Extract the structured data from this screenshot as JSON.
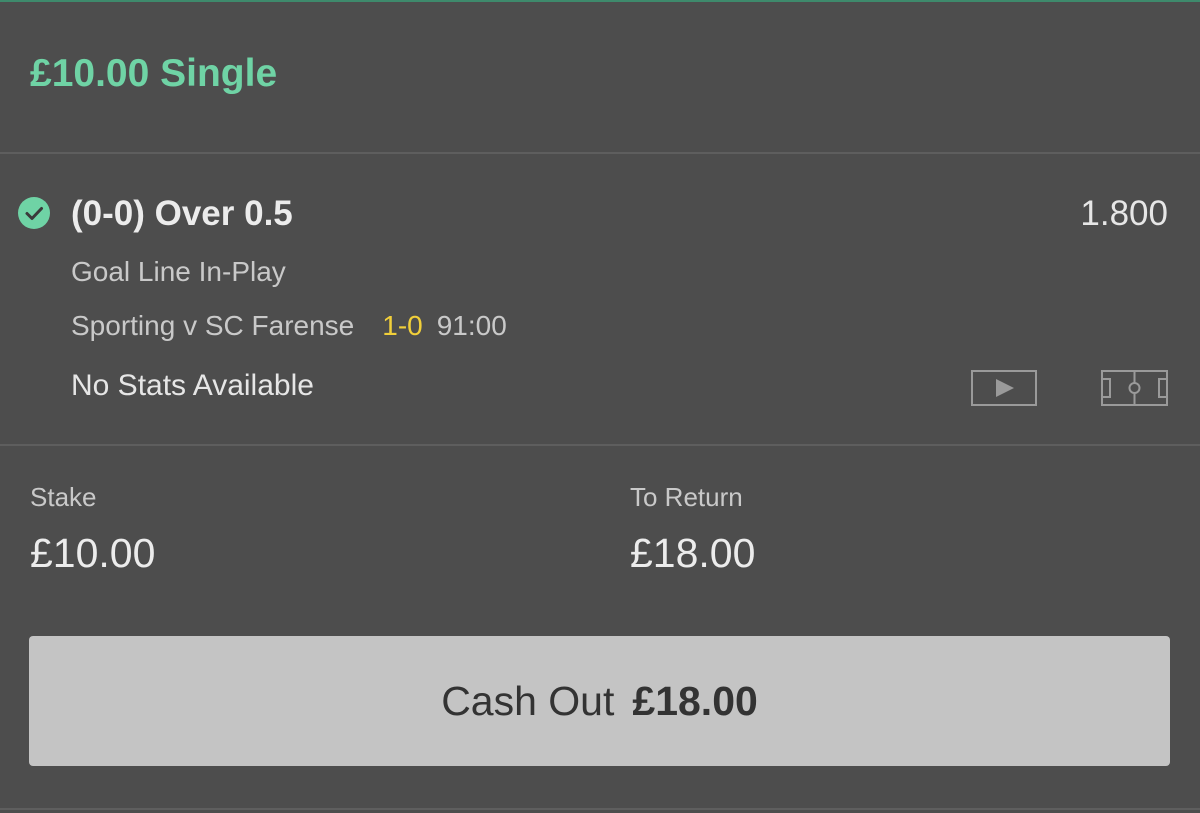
{
  "bet": {
    "title": "£10.00 Single",
    "accent_color": "#6fd3a5"
  },
  "selection": {
    "status_icon": "check-circle-icon",
    "name": "(0-0) Over 0.5",
    "odds": "1.800",
    "market": "Goal Line In-Play",
    "event": "Sporting v SC Farense",
    "score": "1-0",
    "score_color": "#f1cf3a",
    "clock": "91:00",
    "stats_text": "No Stats Available",
    "icons": [
      "video-play-icon",
      "pitch-icon"
    ]
  },
  "stake": {
    "label": "Stake",
    "value": "£10.00"
  },
  "to_return": {
    "label": "To Return",
    "value": "£18.00"
  },
  "cash_out": {
    "label": "Cash Out",
    "amount": "£18.00"
  }
}
